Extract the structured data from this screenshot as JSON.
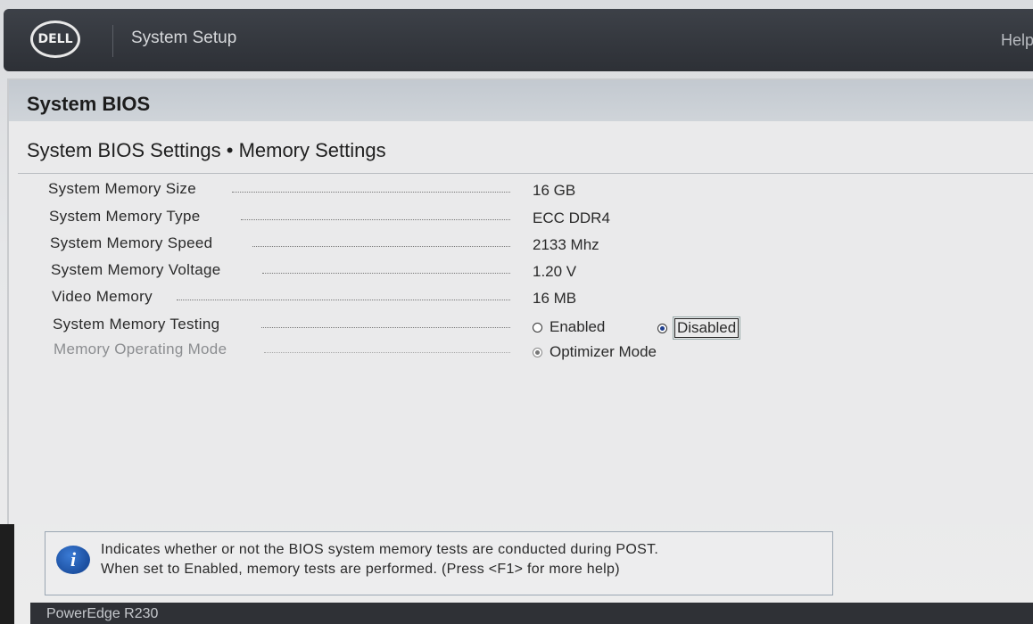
{
  "header": {
    "logo_text": "DELL",
    "app_title": "System Setup",
    "help_label": "Help"
  },
  "panel": {
    "title": "System BIOS",
    "section_title": "System BIOS Settings • Memory Settings"
  },
  "settings": [
    {
      "label": "System Memory Size",
      "value": "16 GB"
    },
    {
      "label": "System Memory Type",
      "value": "ECC DDR4"
    },
    {
      "label": "System Memory Speed",
      "value": "2133 Mhz"
    },
    {
      "label": "System Memory Voltage",
      "value": "1.20 V"
    },
    {
      "label": "Video Memory",
      "value": "16 MB"
    },
    {
      "label": "System Memory Testing",
      "options": [
        "Enabled",
        "Disabled"
      ],
      "selected": "Disabled"
    },
    {
      "label": "Memory Operating Mode",
      "options": [
        "Optimizer Mode"
      ],
      "selected": "Optimizer Mode",
      "disabled": true
    }
  ],
  "help": {
    "line1": "Indicates whether or not the BIOS system memory tests are conducted during POST.",
    "line2": "When set to Enabled, memory tests are performed. (Press <F1> for more help)"
  },
  "footer": {
    "model": "PowerEdge R230"
  },
  "colors": {
    "header_bg": "#2d3036",
    "panel_header_bg": "#c3c9d0",
    "radio_selected": "#1f3f8f",
    "info_icon": "#1c4fa0"
  }
}
